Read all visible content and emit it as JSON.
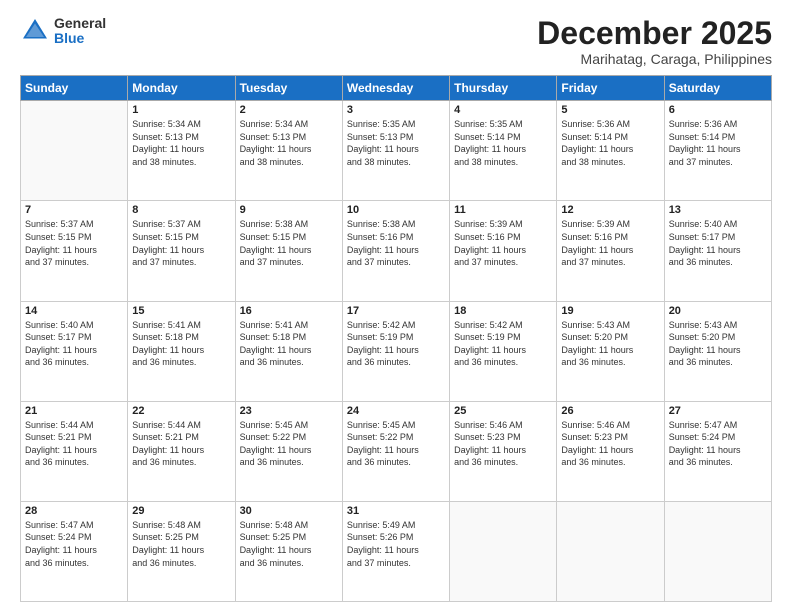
{
  "logo": {
    "general": "General",
    "blue": "Blue"
  },
  "header": {
    "month": "December 2025",
    "location": "Marihatag, Caraga, Philippines"
  },
  "weekdays": [
    "Sunday",
    "Monday",
    "Tuesday",
    "Wednesday",
    "Thursday",
    "Friday",
    "Saturday"
  ],
  "weeks": [
    [
      {
        "day": "",
        "info": ""
      },
      {
        "day": "1",
        "info": "Sunrise: 5:34 AM\nSunset: 5:13 PM\nDaylight: 11 hours\nand 38 minutes."
      },
      {
        "day": "2",
        "info": "Sunrise: 5:34 AM\nSunset: 5:13 PM\nDaylight: 11 hours\nand 38 minutes."
      },
      {
        "day": "3",
        "info": "Sunrise: 5:35 AM\nSunset: 5:13 PM\nDaylight: 11 hours\nand 38 minutes."
      },
      {
        "day": "4",
        "info": "Sunrise: 5:35 AM\nSunset: 5:14 PM\nDaylight: 11 hours\nand 38 minutes."
      },
      {
        "day": "5",
        "info": "Sunrise: 5:36 AM\nSunset: 5:14 PM\nDaylight: 11 hours\nand 38 minutes."
      },
      {
        "day": "6",
        "info": "Sunrise: 5:36 AM\nSunset: 5:14 PM\nDaylight: 11 hours\nand 37 minutes."
      }
    ],
    [
      {
        "day": "7",
        "info": "Sunrise: 5:37 AM\nSunset: 5:15 PM\nDaylight: 11 hours\nand 37 minutes."
      },
      {
        "day": "8",
        "info": "Sunrise: 5:37 AM\nSunset: 5:15 PM\nDaylight: 11 hours\nand 37 minutes."
      },
      {
        "day": "9",
        "info": "Sunrise: 5:38 AM\nSunset: 5:15 PM\nDaylight: 11 hours\nand 37 minutes."
      },
      {
        "day": "10",
        "info": "Sunrise: 5:38 AM\nSunset: 5:16 PM\nDaylight: 11 hours\nand 37 minutes."
      },
      {
        "day": "11",
        "info": "Sunrise: 5:39 AM\nSunset: 5:16 PM\nDaylight: 11 hours\nand 37 minutes."
      },
      {
        "day": "12",
        "info": "Sunrise: 5:39 AM\nSunset: 5:16 PM\nDaylight: 11 hours\nand 37 minutes."
      },
      {
        "day": "13",
        "info": "Sunrise: 5:40 AM\nSunset: 5:17 PM\nDaylight: 11 hours\nand 36 minutes."
      }
    ],
    [
      {
        "day": "14",
        "info": "Sunrise: 5:40 AM\nSunset: 5:17 PM\nDaylight: 11 hours\nand 36 minutes."
      },
      {
        "day": "15",
        "info": "Sunrise: 5:41 AM\nSunset: 5:18 PM\nDaylight: 11 hours\nand 36 minutes."
      },
      {
        "day": "16",
        "info": "Sunrise: 5:41 AM\nSunset: 5:18 PM\nDaylight: 11 hours\nand 36 minutes."
      },
      {
        "day": "17",
        "info": "Sunrise: 5:42 AM\nSunset: 5:19 PM\nDaylight: 11 hours\nand 36 minutes."
      },
      {
        "day": "18",
        "info": "Sunrise: 5:42 AM\nSunset: 5:19 PM\nDaylight: 11 hours\nand 36 minutes."
      },
      {
        "day": "19",
        "info": "Sunrise: 5:43 AM\nSunset: 5:20 PM\nDaylight: 11 hours\nand 36 minutes."
      },
      {
        "day": "20",
        "info": "Sunrise: 5:43 AM\nSunset: 5:20 PM\nDaylight: 11 hours\nand 36 minutes."
      }
    ],
    [
      {
        "day": "21",
        "info": "Sunrise: 5:44 AM\nSunset: 5:21 PM\nDaylight: 11 hours\nand 36 minutes."
      },
      {
        "day": "22",
        "info": "Sunrise: 5:44 AM\nSunset: 5:21 PM\nDaylight: 11 hours\nand 36 minutes."
      },
      {
        "day": "23",
        "info": "Sunrise: 5:45 AM\nSunset: 5:22 PM\nDaylight: 11 hours\nand 36 minutes."
      },
      {
        "day": "24",
        "info": "Sunrise: 5:45 AM\nSunset: 5:22 PM\nDaylight: 11 hours\nand 36 minutes."
      },
      {
        "day": "25",
        "info": "Sunrise: 5:46 AM\nSunset: 5:23 PM\nDaylight: 11 hours\nand 36 minutes."
      },
      {
        "day": "26",
        "info": "Sunrise: 5:46 AM\nSunset: 5:23 PM\nDaylight: 11 hours\nand 36 minutes."
      },
      {
        "day": "27",
        "info": "Sunrise: 5:47 AM\nSunset: 5:24 PM\nDaylight: 11 hours\nand 36 minutes."
      }
    ],
    [
      {
        "day": "28",
        "info": "Sunrise: 5:47 AM\nSunset: 5:24 PM\nDaylight: 11 hours\nand 36 minutes."
      },
      {
        "day": "29",
        "info": "Sunrise: 5:48 AM\nSunset: 5:25 PM\nDaylight: 11 hours\nand 36 minutes."
      },
      {
        "day": "30",
        "info": "Sunrise: 5:48 AM\nSunset: 5:25 PM\nDaylight: 11 hours\nand 36 minutes."
      },
      {
        "day": "31",
        "info": "Sunrise: 5:49 AM\nSunset: 5:26 PM\nDaylight: 11 hours\nand 37 minutes."
      },
      {
        "day": "",
        "info": ""
      },
      {
        "day": "",
        "info": ""
      },
      {
        "day": "",
        "info": ""
      }
    ]
  ]
}
